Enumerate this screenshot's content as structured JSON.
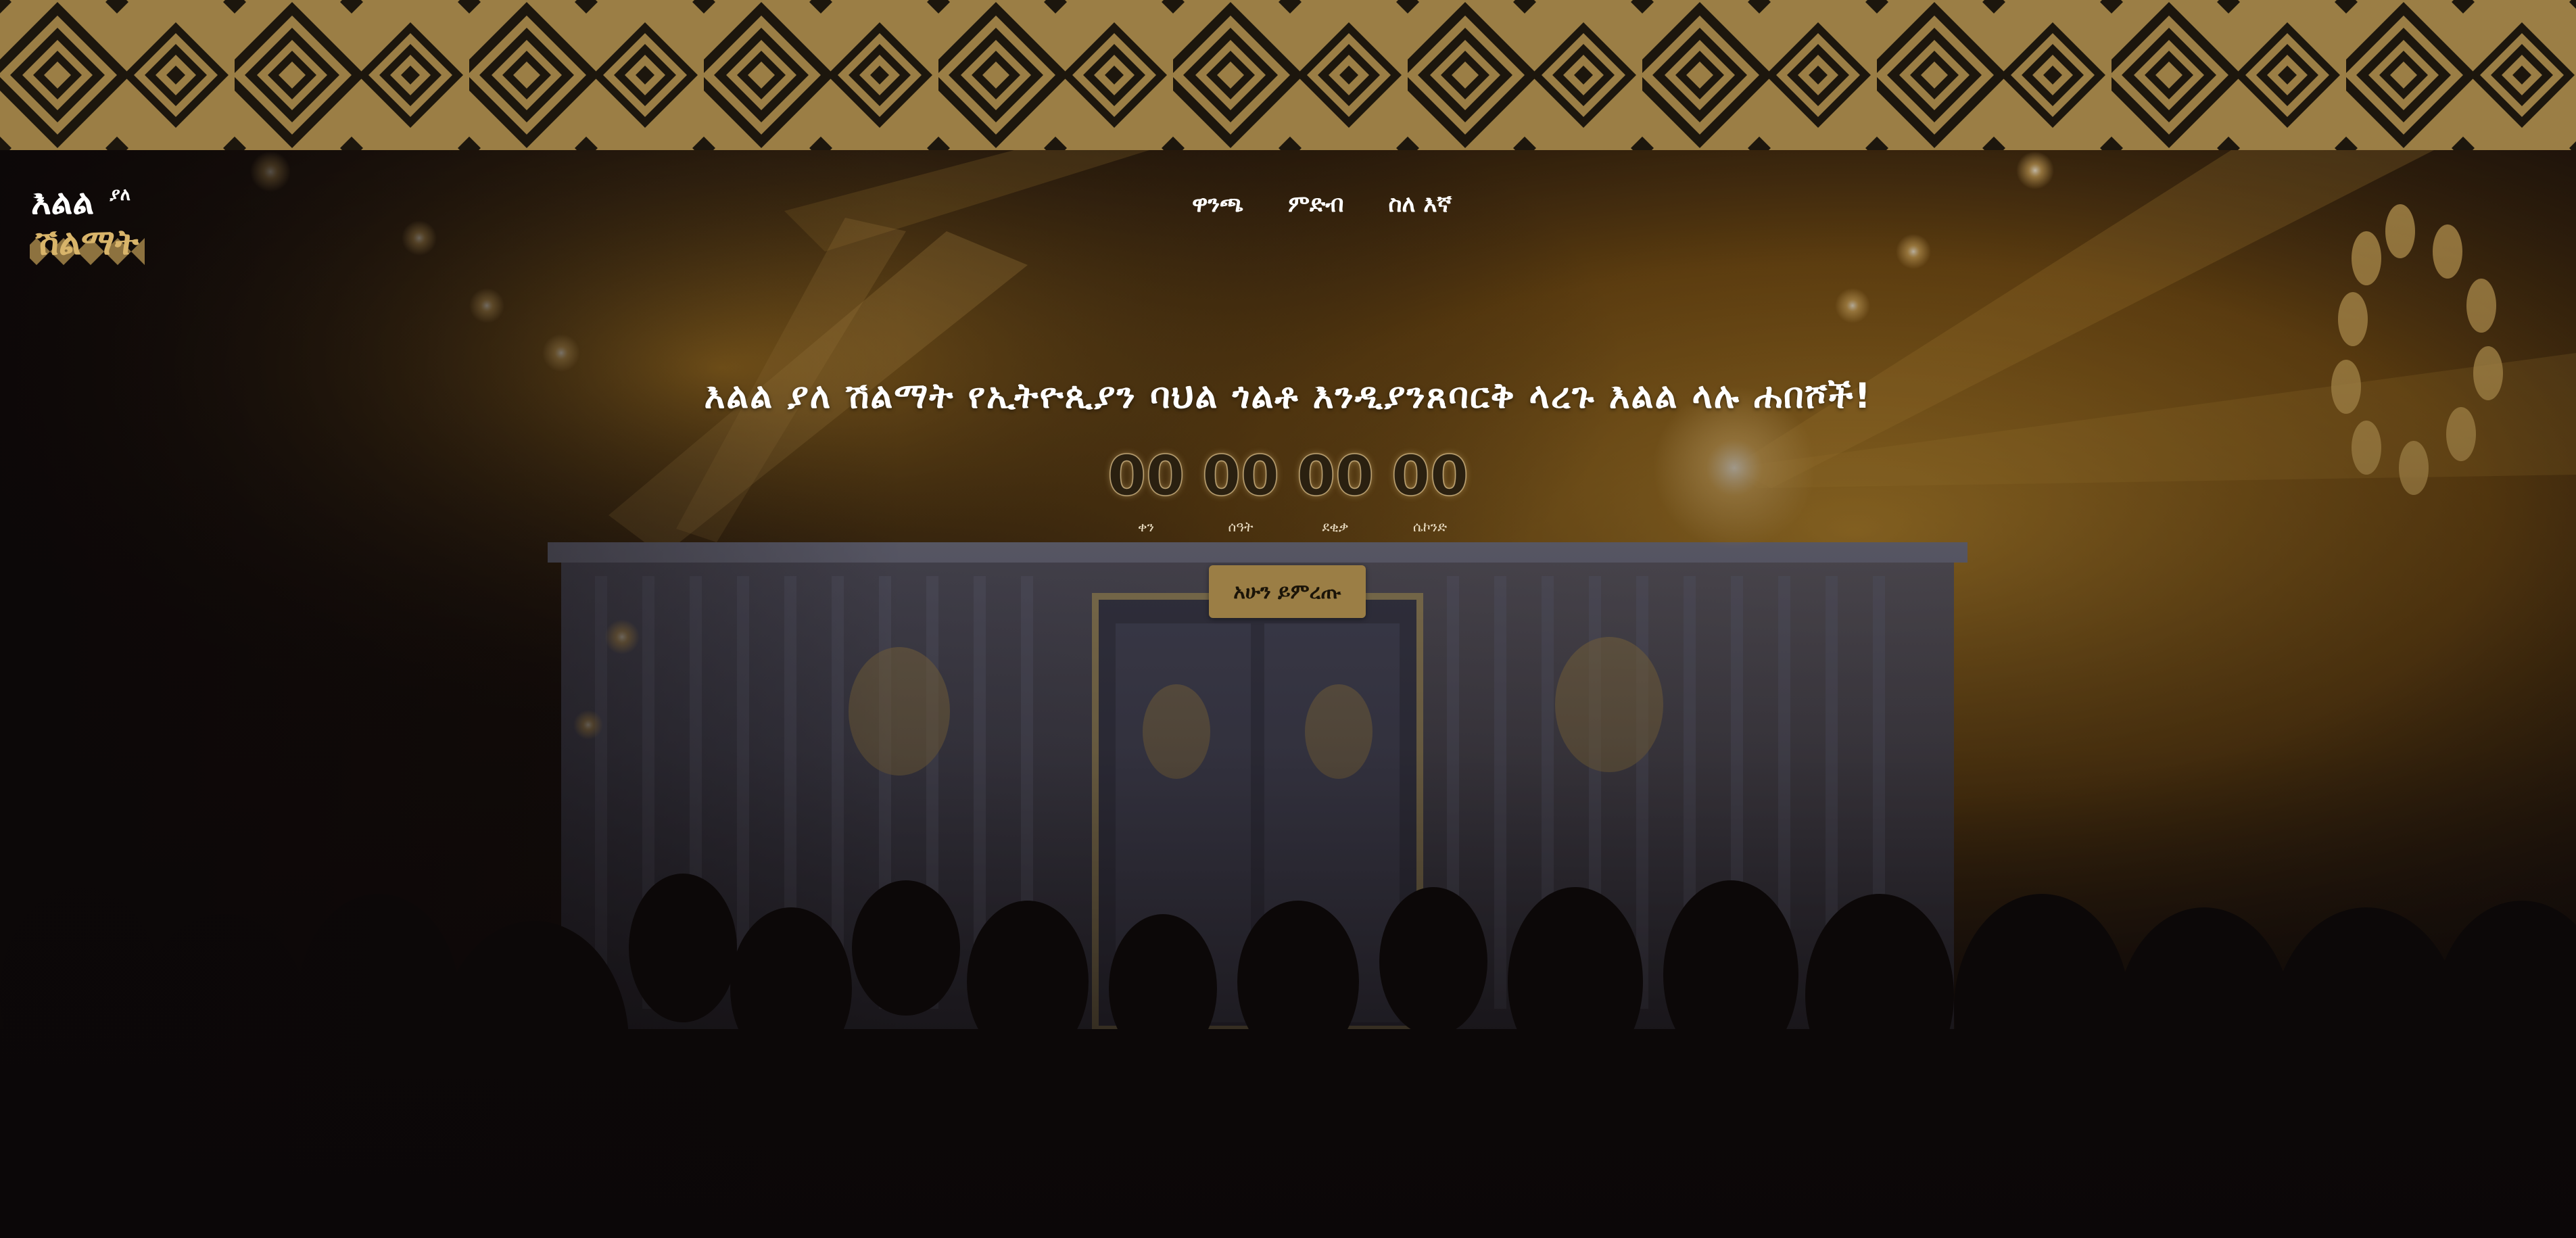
{
  "brand": {
    "logo_text": "እልል ያለ ሽልማት",
    "logo_line1": "እልል",
    "logo_line1_small": "ያለ",
    "logo_line2": "ሽልማት"
  },
  "nav": {
    "items": [
      {
        "label": "ዋንጫ"
      },
      {
        "label": "ምድብ"
      },
      {
        "label": "ስለ እኛ"
      }
    ]
  },
  "hero": {
    "title": "እልል ያለ ሽልማት የኢትዮጲያን ባህል ጎልቶ እንዲያንጸባርቅ ላረጉ እልል ላሉ ሐበሾች!",
    "countdown": [
      {
        "value": "00",
        "label": "ቀን"
      },
      {
        "value": "00",
        "label": "ሰዓት"
      },
      {
        "value": "00",
        "label": "ደቂቃ"
      },
      {
        "value": "00",
        "label": "ሴኮንድ"
      }
    ],
    "cta_label": "አሁን ይምረጡ"
  },
  "colors": {
    "accent_gold": "#9b7e45",
    "pattern_dark": "#1c160d",
    "text_light": "#ffffff",
    "background": "#0b0708"
  },
  "icons": {
    "logo": "ellel-yale-shilmat-logo",
    "pattern": "diamond-pattern-band"
  }
}
